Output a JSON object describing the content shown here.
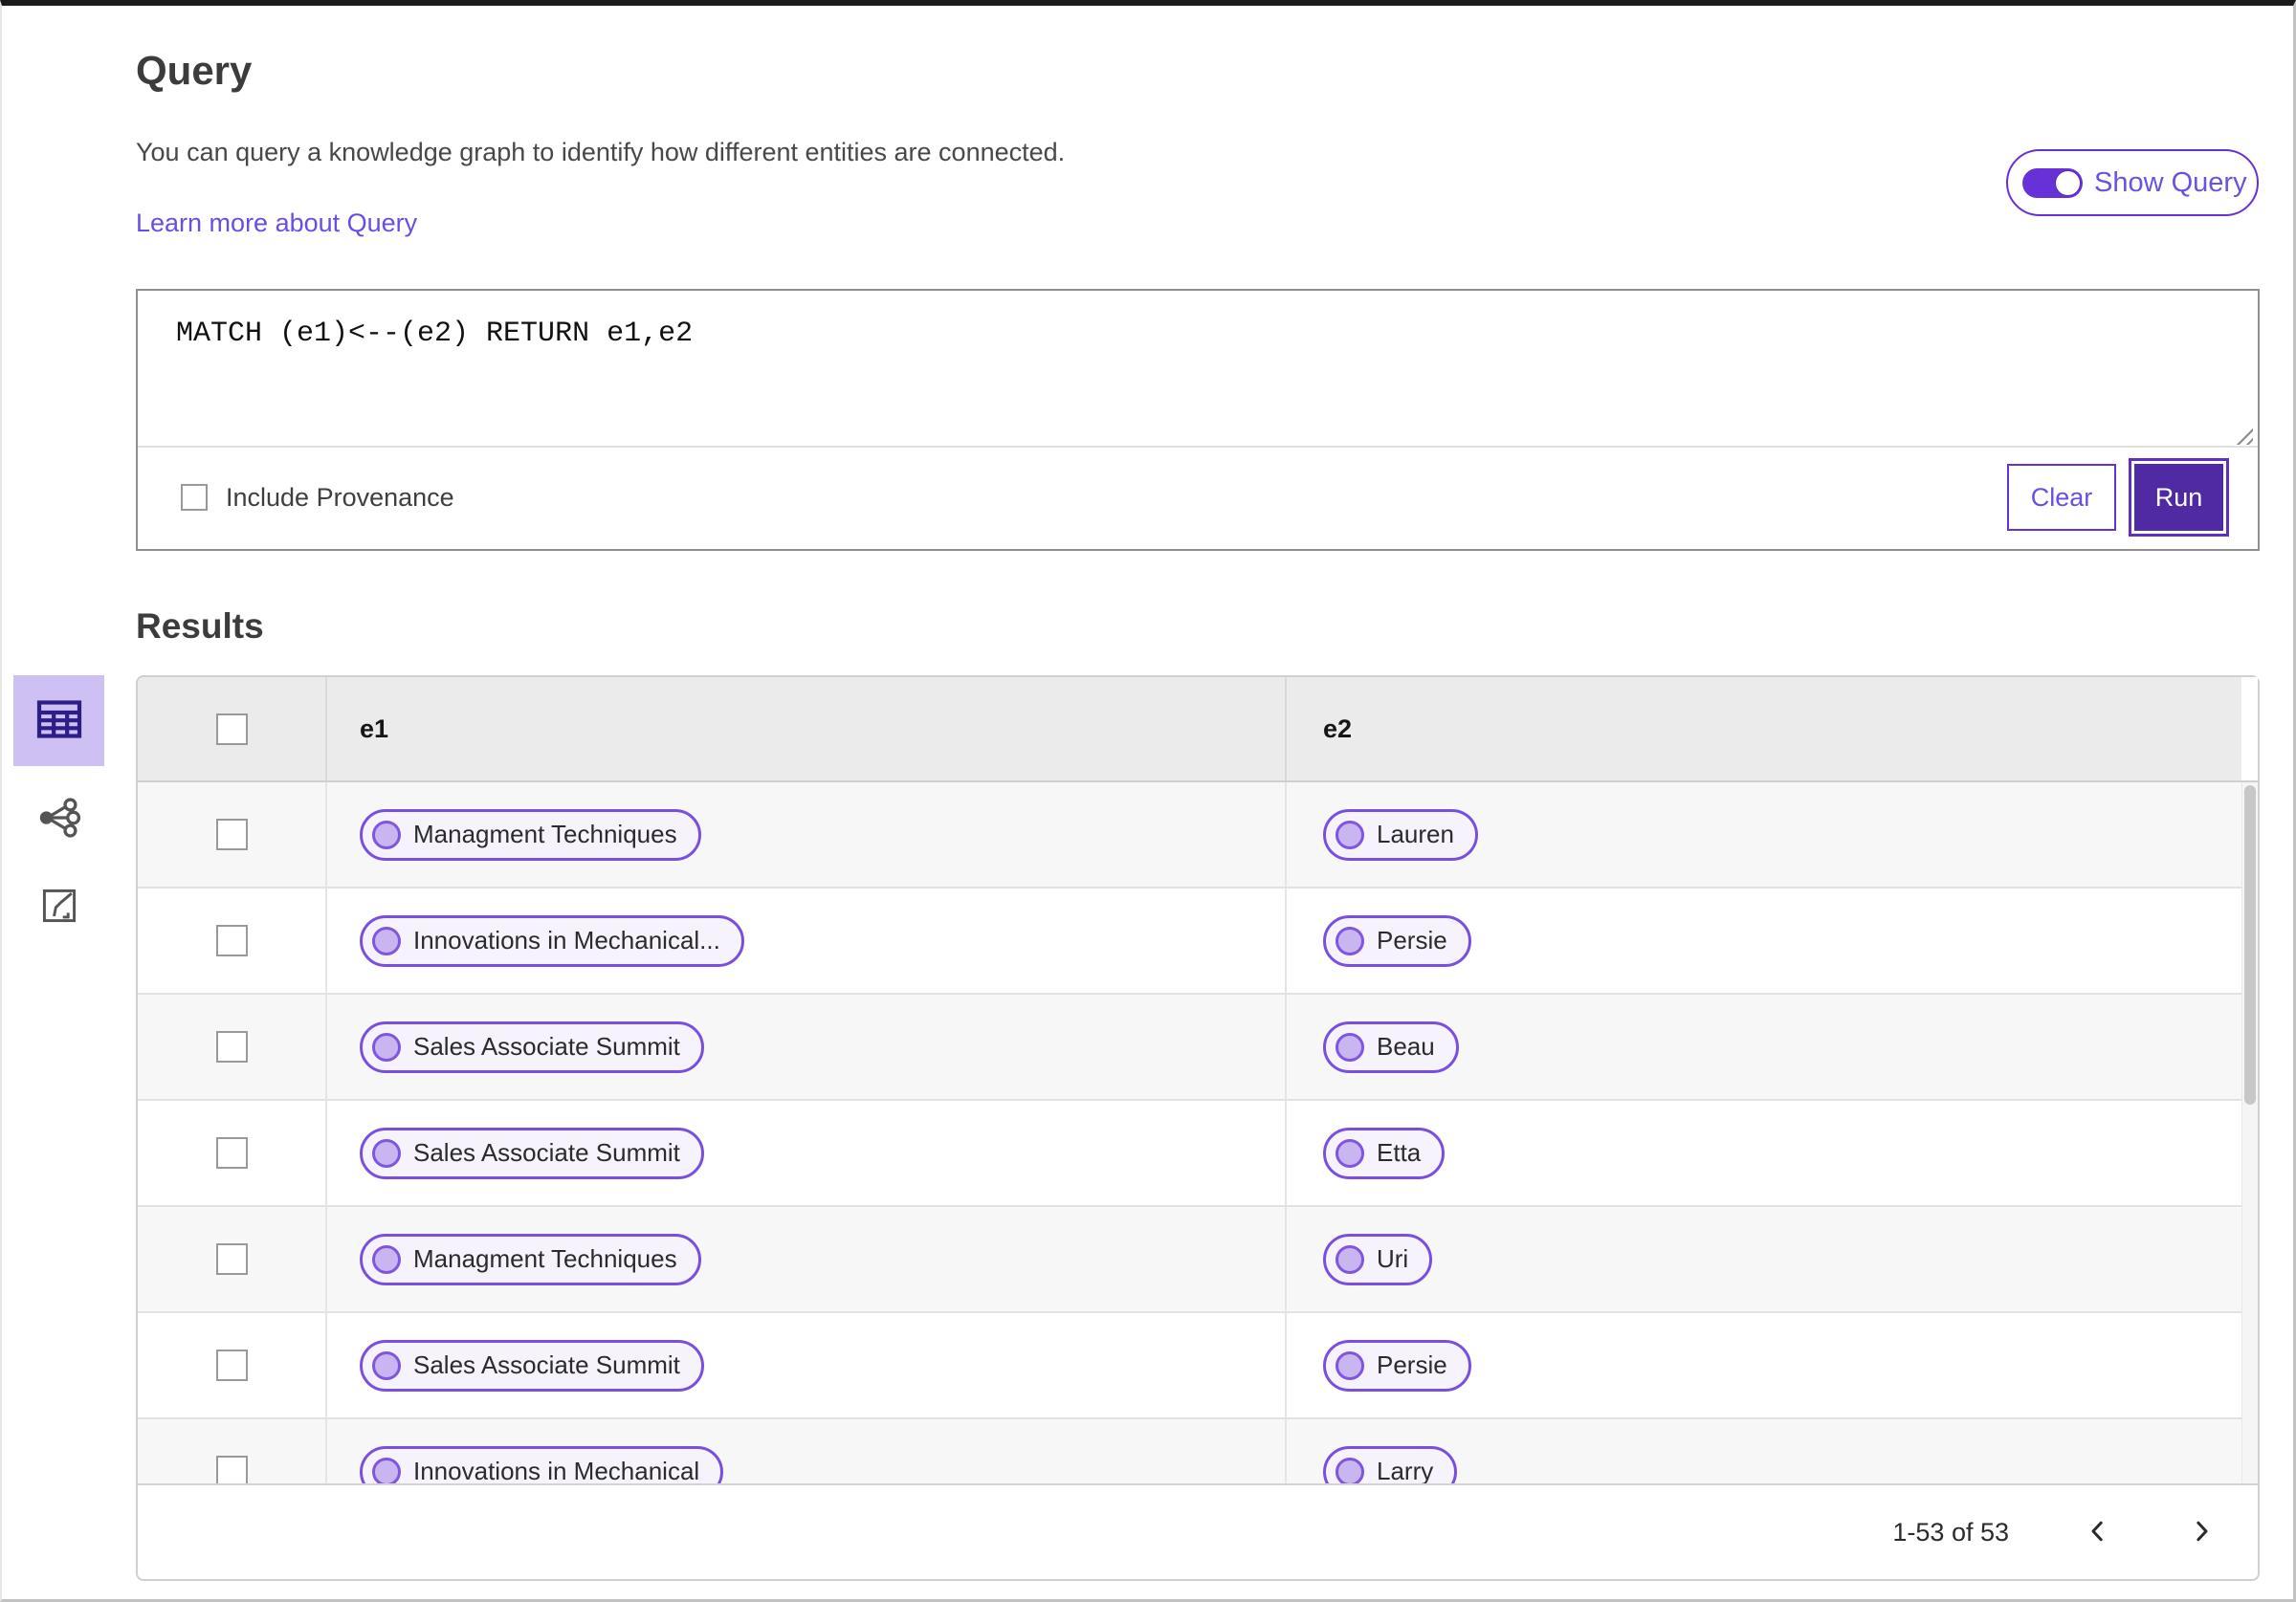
{
  "header": {
    "title": "Query",
    "description": "You can query a knowledge graph to identify how different entities are connected.",
    "learn_more_link": "Learn more about Query",
    "show_query_toggle": {
      "label": "Show Query",
      "state": "on"
    }
  },
  "query_editor": {
    "query_text": "MATCH (e1)<--(e2) RETURN e1,e2",
    "include_provenance": {
      "label": "Include Provenance",
      "checked": false
    },
    "clear_button": "Clear",
    "run_button": "Run"
  },
  "results": {
    "heading": "Results",
    "view_switcher": [
      {
        "name": "table-view",
        "selected": true
      },
      {
        "name": "graph-view",
        "selected": false
      },
      {
        "name": "chart-view",
        "selected": false
      }
    ],
    "table": {
      "columns": [
        "e1",
        "e2"
      ],
      "rows": [
        {
          "e1": "Managment Techniques",
          "e2": "Lauren"
        },
        {
          "e1": "Innovations in Mechanical...",
          "e2": "Persie"
        },
        {
          "e1": "Sales Associate Summit",
          "e2": "Beau"
        },
        {
          "e1": "Sales Associate Summit",
          "e2": "Etta"
        },
        {
          "e1": "Managment Techniques",
          "e2": "Uri"
        },
        {
          "e1": "Sales Associate Summit",
          "e2": "Persie"
        },
        {
          "e1": "Innovations in Mechanical",
          "e2": "Larry"
        }
      ]
    },
    "pagination": {
      "range_label": "1-53 of 53"
    }
  },
  "colors": {
    "accent_purple": "#6731d8",
    "run_button_bg": "#4f2aa3",
    "link_purple": "#6b4de4",
    "pill_border": "#7a4fe0",
    "pill_dot": "#c9b6f1",
    "selected_view_bg": "#cfc0f4",
    "selected_view_icon": "#2d1d86"
  }
}
